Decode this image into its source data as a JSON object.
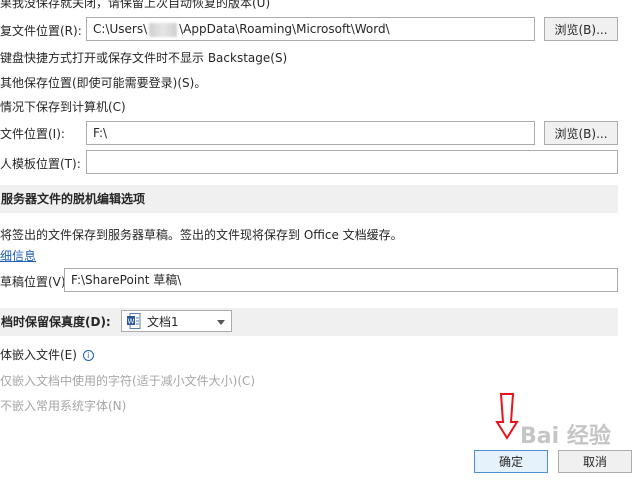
{
  "top_note": "果我没保存就关闭，请保留上次自动恢复的版本(U)",
  "autorecover": {
    "label": "复文件位置(R):",
    "path_prefix": "C:\\Users\\",
    "path_suffix": "\\AppData\\Roaming\\Microsoft\\Word\\",
    "browse": "浏览(B)..."
  },
  "options": {
    "keyboard_backstage": "键盘快捷方式打开或保存文件时不显示 Backstage(S)",
    "other_locations": "其他保存位置(即使可能需要登录)(S)。",
    "default_computer": "情况下保存到计算机(C)"
  },
  "local_location": {
    "label": "文件位置(I):",
    "value": "F:\\",
    "browse": "浏览(B)..."
  },
  "templates": {
    "label": "人模板位置(T):",
    "value": ""
  },
  "server_section": {
    "title": "服务器文件的脱机编辑选项",
    "description": "将签出的文件保存到服务器草稿。签出的文件现将保存到 Office 文档缓存。",
    "more_info": "细信息",
    "drafts_label": "草稿位置(V):",
    "drafts_value": "F:\\SharePoint 草稿\\"
  },
  "fidelity_section": {
    "title": "档时保留保真度(D):",
    "doc_select": "文档1",
    "embed_fonts": "体嵌入文件(E)",
    "embed_used_chars": "仅嵌入文档中使用的字符(适于减小文件大小)(C)",
    "no_common_fonts": "不嵌入常用系统字体(N)"
  },
  "footer": {
    "ok": "确定",
    "cancel": "取消"
  },
  "watermark": "Bai 经验",
  "colors": {
    "section_bg": "#f0f0f0",
    "link": "#1f5fb5",
    "arrow": "#e8141b"
  }
}
